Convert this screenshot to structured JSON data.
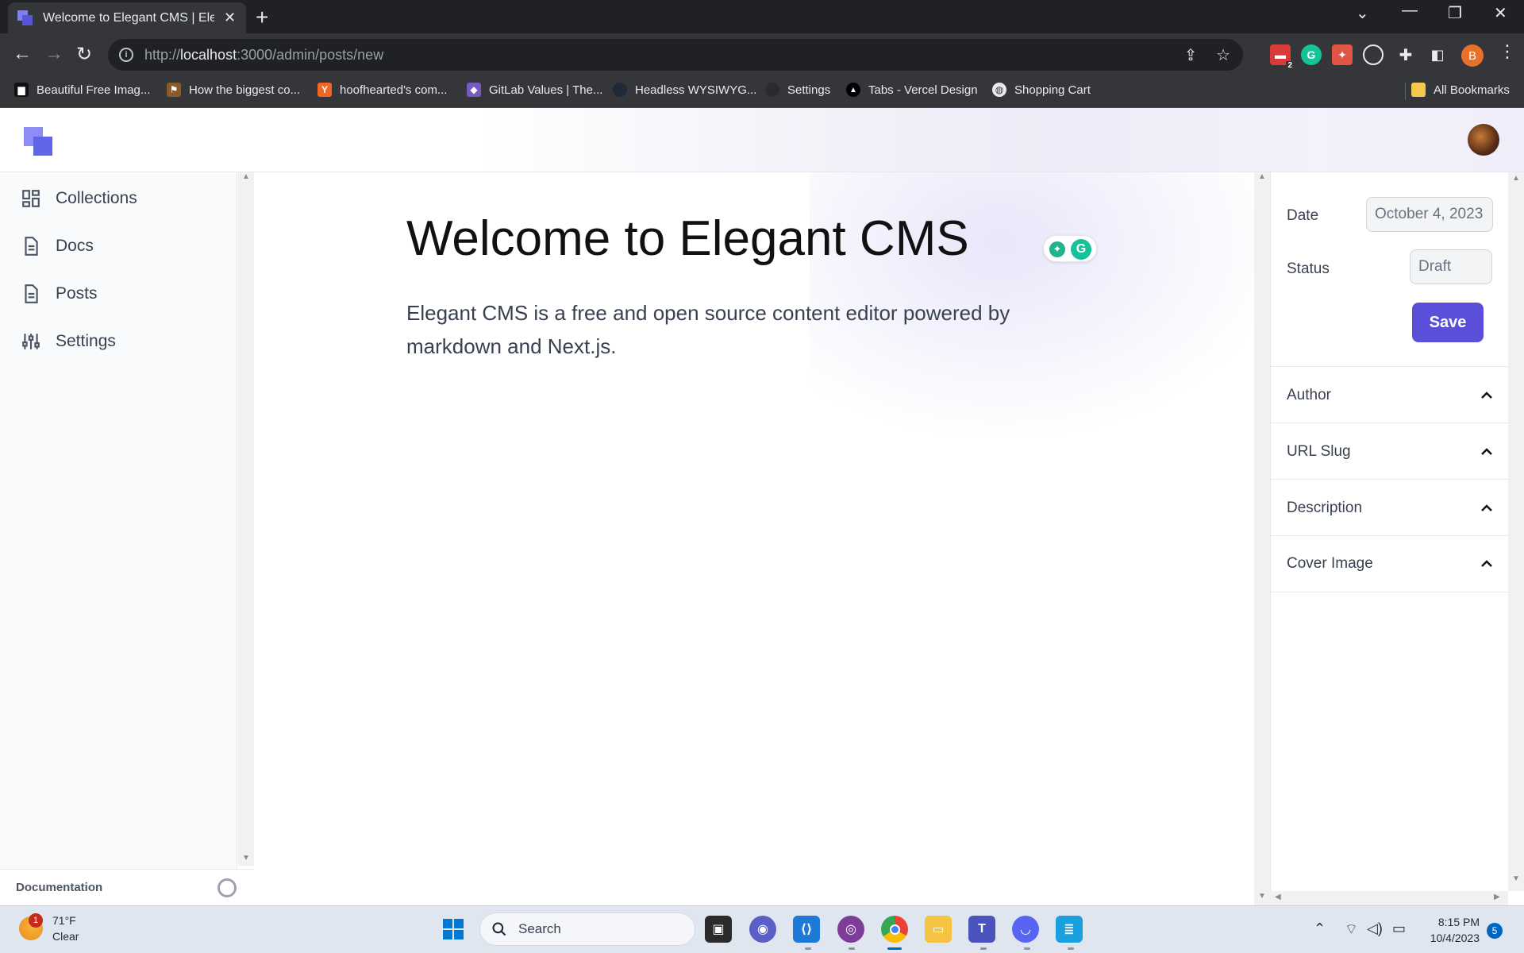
{
  "browser": {
    "tab_title": "Welcome to Elegant CMS | Elegant CMS",
    "url_scheme": "http://",
    "url_host": "localhost",
    "url_path": ":3000/admin/posts/new",
    "extension_badge": "2",
    "profile_initial": "B",
    "bookmarks": [
      {
        "label": "Beautiful Free Imag...",
        "icon": "unsplash-icon",
        "color": "#111111"
      },
      {
        "label": "How the biggest co...",
        "icon": "bookmark-favicon-icon",
        "color": "#8a5a2b"
      },
      {
        "label": "hoofhearted's com...",
        "icon": "y-combinator-icon",
        "color": "#f26522",
        "glyph": "Y"
      },
      {
        "label": "GitLab Values | The...",
        "icon": "gitlab-icon",
        "color": "#7759c2"
      },
      {
        "label": "Headless WYSIWYG...",
        "icon": "globe-dark-icon",
        "color": "#1f2937"
      },
      {
        "label": "Settings",
        "icon": "github-icon",
        "color": "#2b2b2b"
      },
      {
        "label": "Tabs - Vercel Design",
        "icon": "vercel-icon",
        "color": "#000000",
        "glyph": "▲"
      },
      {
        "label": "Shopping Cart",
        "icon": "globe-icon",
        "color": "#35363a"
      }
    ],
    "all_bookmarks": "All Bookmarks"
  },
  "app": {
    "nav": [
      {
        "label": "Collections",
        "icon": "grid-icon"
      },
      {
        "label": "Docs",
        "icon": "document-icon"
      },
      {
        "label": "Posts",
        "icon": "document-icon"
      },
      {
        "label": "Settings",
        "icon": "sliders-icon"
      }
    ],
    "footer_link": "Documentation",
    "title": "Welcome to Elegant CMS",
    "body": "Elegant CMS is a free and open source content editor powered by markdown and Next.js.",
    "panel": {
      "date_label": "Date",
      "date_value": "October 4, 2023",
      "status_label": "Status",
      "status_value": "Draft",
      "save_label": "Save",
      "sections": [
        "Author",
        "URL Slug",
        "Description",
        "Cover Image"
      ]
    },
    "accent_color": "#5a4fd9"
  },
  "taskbar": {
    "weather_temp": "71°F",
    "weather_desc": "Clear",
    "weather_badge": "1",
    "search_placeholder": "Search",
    "time": "8:15 PM",
    "date": "10/4/2023",
    "notifications": "5"
  }
}
